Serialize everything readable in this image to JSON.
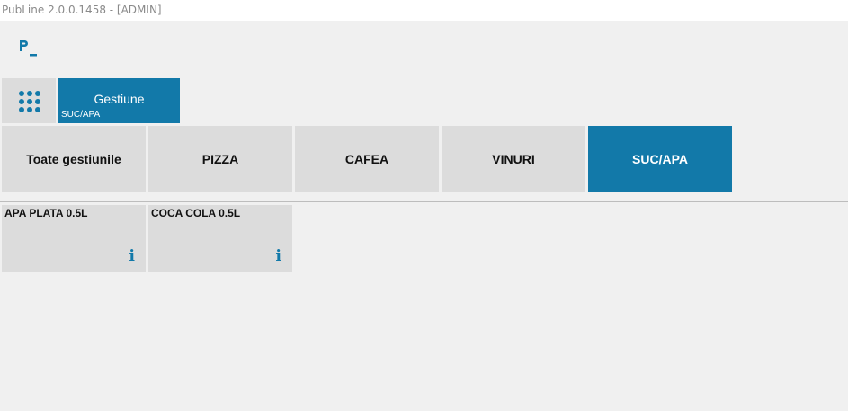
{
  "window": {
    "title": "PubLine 2.0.0.1458 - [ADMIN]"
  },
  "colors": {
    "accent": "#1279a9",
    "tile": "#dcdcdc",
    "background": "#f0f0f0"
  },
  "icons": {
    "logo": "publine-logo-icon",
    "menu": "grid-icon",
    "info": "info-icon"
  },
  "header": {
    "gestiune": {
      "label": "Gestiune",
      "current": "SUC/APA"
    }
  },
  "categories": [
    {
      "label": "Toate gestiunile",
      "active": false
    },
    {
      "label": "PIZZA",
      "active": false
    },
    {
      "label": "CAFEA",
      "active": false
    },
    {
      "label": "VINURI",
      "active": false
    },
    {
      "label": "SUC/APA",
      "active": true
    }
  ],
  "products": [
    {
      "name": "APA PLATA 0.5L",
      "info_icon": "i"
    },
    {
      "name": "COCA COLA 0.5L",
      "info_icon": "i"
    }
  ]
}
